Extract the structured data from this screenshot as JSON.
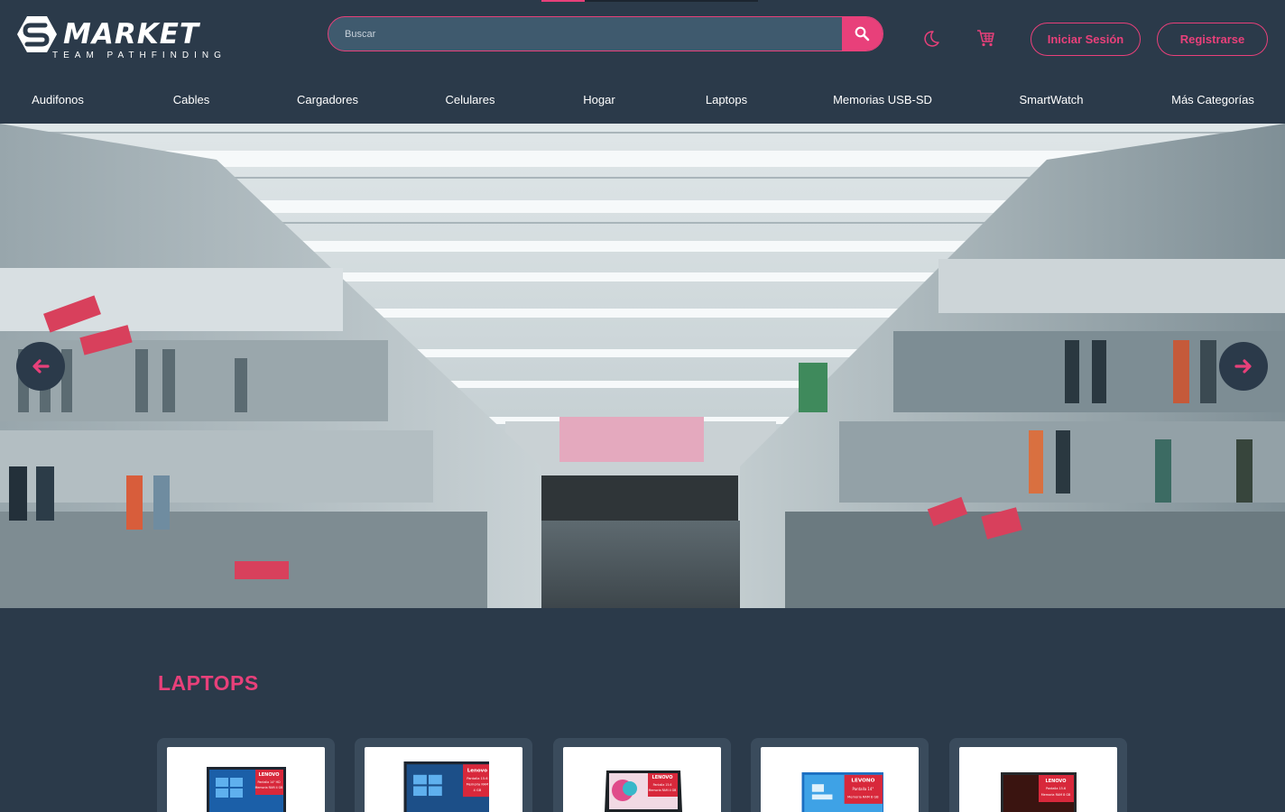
{
  "header": {
    "logo": {
      "name": "MARKET",
      "tagline": "TEAM PATHFINDING"
    },
    "search": {
      "placeholder": "Buscar",
      "value": ""
    },
    "login_label": "Iniciar Sesión",
    "register_label": "Registrarse",
    "icons": [
      "search-icon",
      "moon-icon",
      "cart-icon"
    ]
  },
  "loading": {
    "progress": 0.2
  },
  "categories": [
    {
      "label": "Audifonos"
    },
    {
      "label": "Cables"
    },
    {
      "label": "Cargadores"
    },
    {
      "label": "Celulares"
    },
    {
      "label": "Hogar"
    },
    {
      "label": "Laptops"
    },
    {
      "label": "Memorias USB-SD"
    },
    {
      "label": "SmartWatch"
    },
    {
      "label": "Más Categorías"
    }
  ],
  "carousel": {
    "image": "supermarket-aisle-photo",
    "prev_icon": "arrow-left-icon",
    "next_icon": "arrow-right-icon"
  },
  "section": {
    "title": "LAPTOPS",
    "products": [
      {
        "brand": "LENOVO",
        "badge_text": [
          "Pantalla 14\" HD",
          "Memoria RAM 4 GB"
        ]
      },
      {
        "brand": "Lenovo",
        "badge_text": [
          "Pantalla 15.6",
          "Memoria RAM",
          "4 GB"
        ]
      },
      {
        "brand": "LENOVO",
        "badge_text": [
          "Pantalla 15.6",
          "Memoria RAM 4 GB"
        ]
      },
      {
        "brand": "LEVONO",
        "badge_text": [
          "Pantalla 14\"",
          "Memoria RAM 8 GB"
        ]
      },
      {
        "brand": "LENOVO",
        "badge_text": [
          "Pantalla 15.6",
          "Memoria RAM 8 GB"
        ]
      }
    ]
  },
  "colors": {
    "background": "#2b3a4a",
    "accent": "#e8407a",
    "search_bg": "#3f5a6e",
    "card_bg": "#3a4b5c"
  }
}
